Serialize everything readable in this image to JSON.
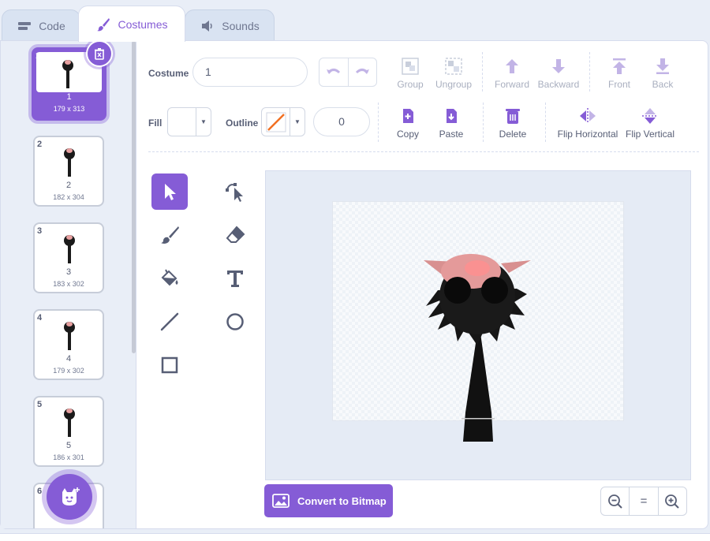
{
  "tabs": [
    {
      "label": "Code",
      "icon": "code-icon"
    },
    {
      "label": "Costumes",
      "icon": "brush-icon"
    },
    {
      "label": "Sounds",
      "icon": "speaker-icon"
    }
  ],
  "costumes": [
    {
      "num": "1",
      "name": "1",
      "size": "179 x 313",
      "selected": true
    },
    {
      "num": "2",
      "name": "2",
      "size": "182 x 304"
    },
    {
      "num": "3",
      "name": "3",
      "size": "183 x 302"
    },
    {
      "num": "4",
      "name": "4",
      "size": "179 x 302"
    },
    {
      "num": "5",
      "name": "5",
      "size": "186 x 301"
    },
    {
      "num": "6"
    }
  ],
  "toolbar": {
    "costume_label": "Costume",
    "costume_name": "1",
    "fill_label": "Fill",
    "outline_label": "Outline",
    "outline_width": "0",
    "group": "Group",
    "ungroup": "Ungroup",
    "forward": "Forward",
    "backward": "Backward",
    "front": "Front",
    "back": "Back",
    "copy": "Copy",
    "paste": "Paste",
    "delete": "Delete",
    "flip_h": "Flip Horizontal",
    "flip_v": "Flip Vertical"
  },
  "canvas": {
    "convert_label": "Convert to Bitmap"
  },
  "zoom": {
    "zoom_out": "−",
    "reset": "=",
    "zoom_in": "+"
  },
  "colors": {
    "accent": "#855cd6",
    "panel_bg": "#e9eef7"
  }
}
